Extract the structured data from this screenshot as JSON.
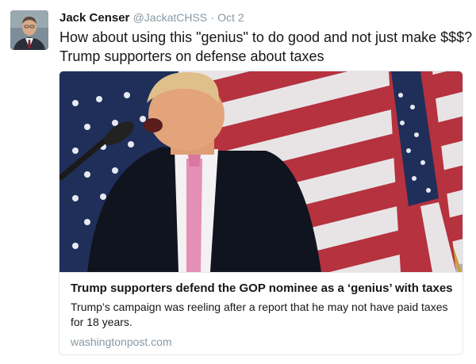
{
  "tweet": {
    "author_name": "Jack Censer",
    "author_handle": "@JackatCHSS",
    "separator": "·",
    "date": "Oct 2",
    "text_line1": "How about using this \"genius\" to do good and not just make $$$?",
    "text_line2": "Trump supporters on defense about  taxes"
  },
  "card": {
    "image_icon": "photo-of-speaker-with-flag",
    "title": "Trump supporters defend the GOP nominee as a ‘genius’ with taxes",
    "description": "Trump’s campaign was reeling after a report that he may not have paid taxes for 18 years.",
    "domain": "washingtonpost.com"
  },
  "colors": {
    "text": "#14171a",
    "muted": "#8899a6",
    "border": "#e1e8ed"
  }
}
